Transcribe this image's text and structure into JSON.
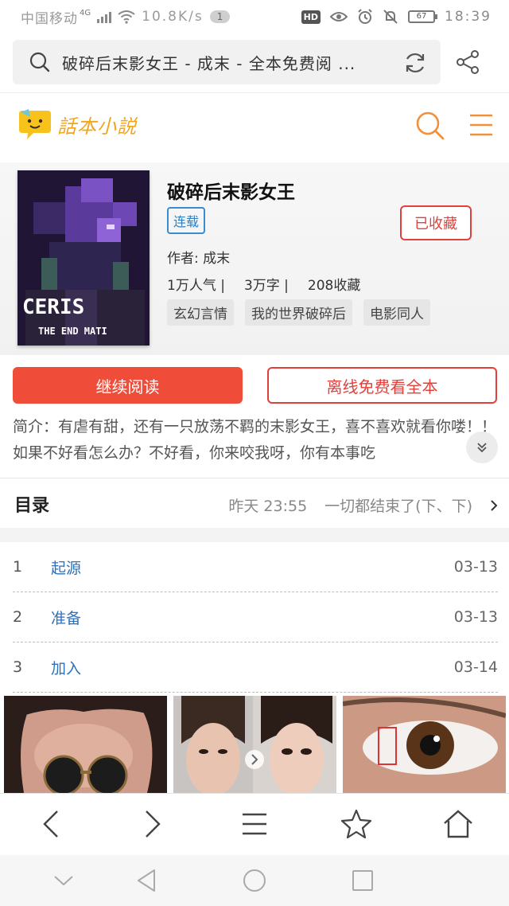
{
  "status_bar": {
    "carrier": "中国移动",
    "network": "4G",
    "speed": "10.8K/s",
    "notification_count": "1",
    "hd_label": "HD",
    "battery": "67",
    "time": "18:39"
  },
  "browser": {
    "url_text": "破碎后末影女王 - 成末 - 全本免费阅 ..."
  },
  "site": {
    "logo_text": "話本小説"
  },
  "book": {
    "title": "破碎后末影女王",
    "status_tag": "连载",
    "favorite_label": "已收藏",
    "author": "作者: 成末",
    "popularity": "1万人气 |",
    "word_count": "3万字 |",
    "favorites": "208收藏",
    "tags": [
      "玄幻言情",
      "我的世界破碎后",
      "电影同人"
    ],
    "cover_title": "CERIS",
    "cover_subtitle": "THE END MATI"
  },
  "actions": {
    "continue_label": "继续阅读",
    "offline_label": "离线免费看全本"
  },
  "intro": {
    "text": "简介：有虐有甜，还有一只放荡不羁的末影女王，喜不喜欢就看你喽！！如果不好看怎么办？不好看，你来咬我呀，你有本事吃"
  },
  "toc": {
    "title": "目录",
    "latest_time": "昨天 23:55",
    "latest_chapter": "一切都结束了(下、下)",
    "chapters": [
      {
        "num": "1",
        "title": "起源",
        "date": "03-13"
      },
      {
        "num": "2",
        "title": "准备",
        "date": "03-13"
      },
      {
        "num": "3",
        "title": "加入",
        "date": "03-14"
      }
    ]
  },
  "colors": {
    "accent_red": "#ef4d3a",
    "link_blue": "#2d72b8",
    "logo_orange": "#f2a51a"
  }
}
